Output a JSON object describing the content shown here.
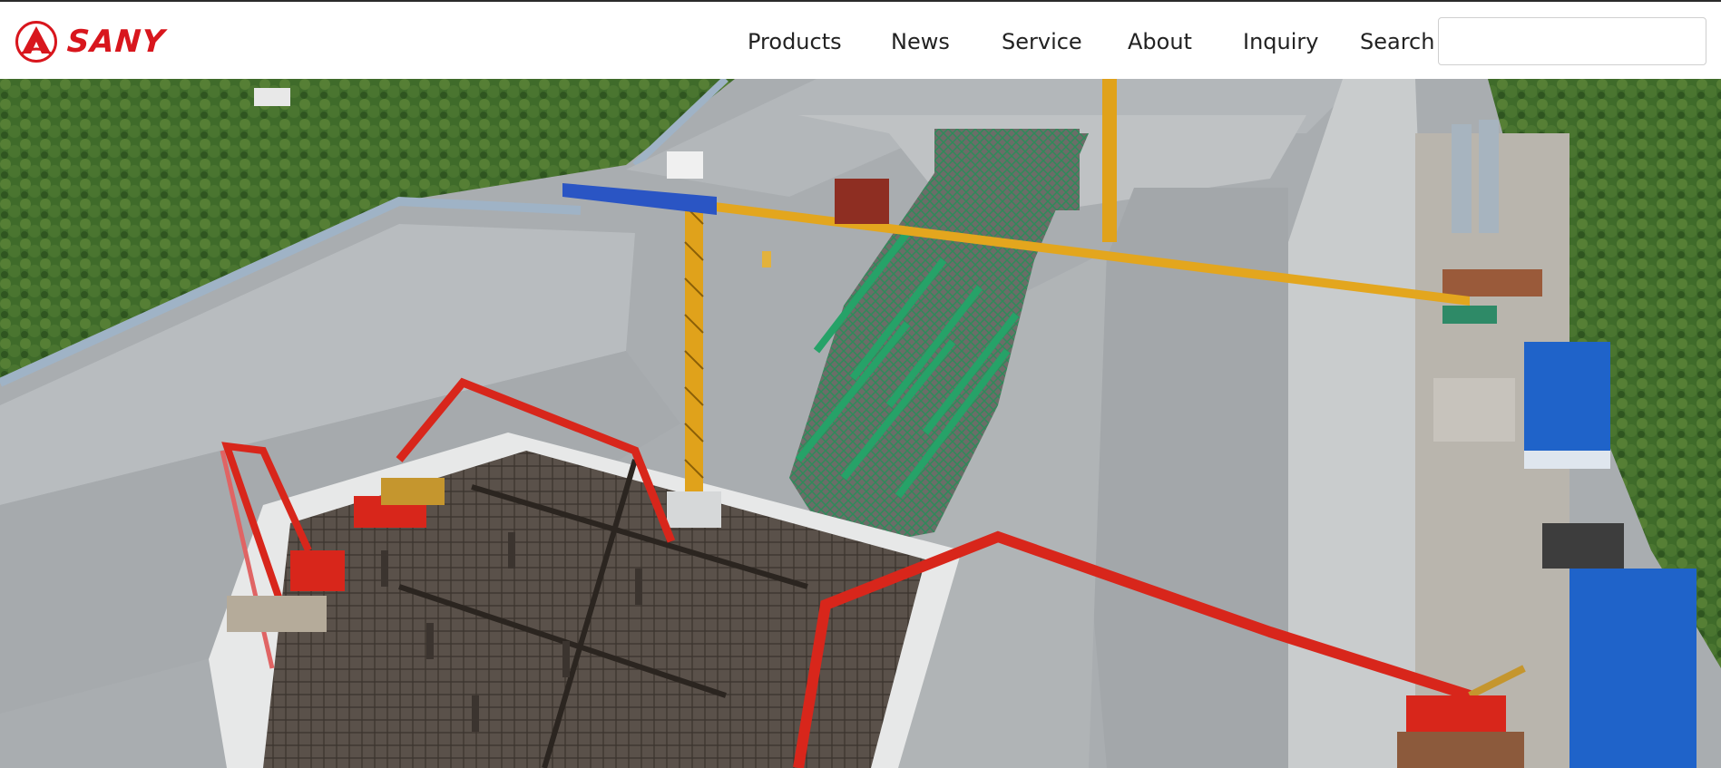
{
  "brand": {
    "name": "SANY",
    "color": "#d8161d",
    "logo_icon": "sany-triangle-logo-icon"
  },
  "nav": {
    "items": [
      {
        "label": "Products"
      },
      {
        "label": "News"
      },
      {
        "label": "Service"
      },
      {
        "label": "About"
      },
      {
        "label": "Inquiry"
      }
    ],
    "search_label": "Search",
    "search_value": "",
    "search_placeholder": ""
  },
  "hero": {
    "subject": "aerial view of construction site with tower crane and concrete pump trucks"
  }
}
